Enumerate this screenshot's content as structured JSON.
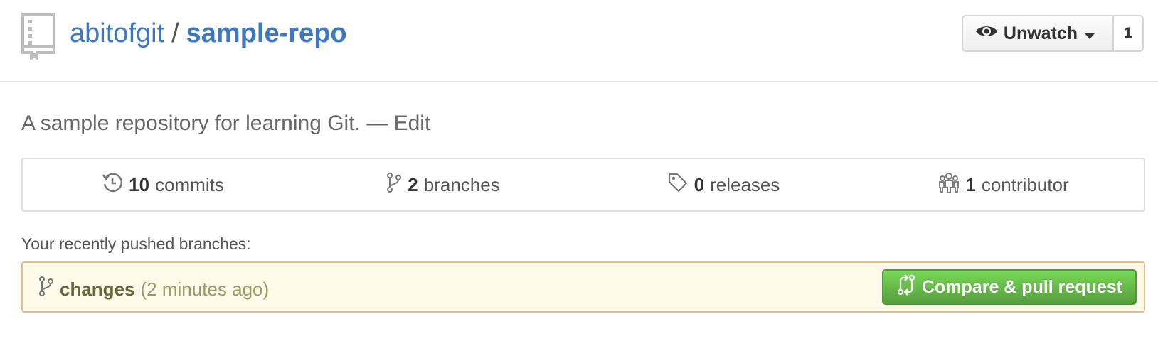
{
  "repo": {
    "owner": "abitofgit",
    "separator": "/",
    "name": "sample-repo"
  },
  "watch": {
    "label": "Unwatch",
    "count": "1"
  },
  "description": {
    "text": "A sample repository for learning Git.",
    "dash": "—",
    "edit_label": "Edit"
  },
  "numbers": [
    {
      "icon": "history-icon",
      "count": "10",
      "label": "commits"
    },
    {
      "icon": "git-branch-icon",
      "count": "2",
      "label": "branches"
    },
    {
      "icon": "tag-icon",
      "count": "0",
      "label": "releases"
    },
    {
      "icon": "organization-icon",
      "count": "1",
      "label": "contributor"
    }
  ],
  "recent": {
    "label": "Your recently pushed branches:",
    "branch": "changes",
    "time": "(2 minutes ago)",
    "compare_label": "Compare & pull request"
  },
  "colors": {
    "link": "#4078c0",
    "compare_button": "#6cc644",
    "banner_bg": "#fff9ea",
    "banner_border": "#e2c08d"
  }
}
